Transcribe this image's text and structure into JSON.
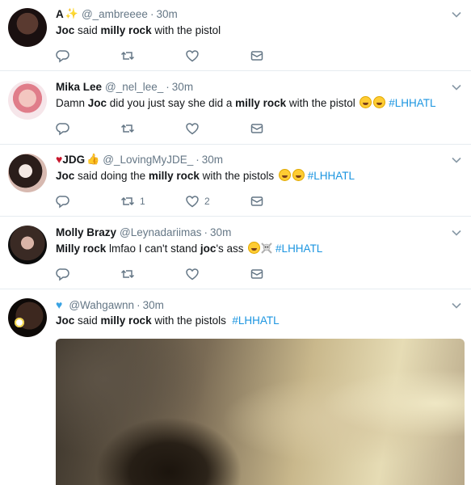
{
  "tweets": [
    {
      "name": "A",
      "name_emoji": "sparkles",
      "handle": "@_ambreeee",
      "time": "30m",
      "text": {
        "w1": "Joc",
        "w2": " said ",
        "w3": "milly rock",
        "w4": " with the pistol"
      },
      "actions": {
        "retweets": "",
        "likes": ""
      }
    },
    {
      "name": "Mika Lee",
      "handle": "@_nel_lee_",
      "time": "30m",
      "text": {
        "w1": "Damn ",
        "w2": "Joc",
        "w3": " did you just say she did a ",
        "w4": "milly rock",
        "w5": " with the pistol ",
        "hashtag": "#LHHATL"
      },
      "emojis": [
        "face-with-tears-of-joy",
        "face-with-tears-of-joy"
      ],
      "actions": {
        "retweets": "",
        "likes": ""
      }
    },
    {
      "name_prefix_emoji": "red-heart",
      "name": "JDG",
      "name_emoji": "thumbs-up-medium-skin",
      "handle": "@_LovingMyJDE_",
      "time": "30m",
      "text": {
        "w1": "Joc",
        "w2": " said doing the ",
        "w3": "milly rock",
        "w4": " with the pistols ",
        "hashtag": "#LHHATL"
      },
      "emojis": [
        "face-with-tears-of-joy",
        "face-with-tears-of-joy"
      ],
      "actions": {
        "retweets": "1",
        "likes": "2"
      }
    },
    {
      "name": "Molly Brazy",
      "handle": "@Leynadariimas",
      "time": "30m",
      "text": {
        "w1": "Milly rock",
        "w2": " lmfao I can't stand ",
        "w3": "joc",
        "w4": "'s ass ",
        "hashtag": "#LHHATL"
      },
      "emojis": [
        "face-with-tears-of-joy",
        "skull-and-crossbones"
      ],
      "actions": {
        "retweets": "",
        "likes": ""
      }
    },
    {
      "name_prefix_emoji": "blue-heart",
      "name": "",
      "handle": "@Wahgawnn",
      "time": "30m",
      "text": {
        "w1": "Joc",
        "w2": " said ",
        "w3": "milly rock",
        "w4": " with the pistols  ",
        "hashtag": "#LHHATL"
      },
      "media": "blurred-video-still"
    }
  ],
  "colors": {
    "text": "#14171a",
    "muted": "#657786",
    "link": "#1b95e0",
    "divider": "#e6ecf0"
  }
}
